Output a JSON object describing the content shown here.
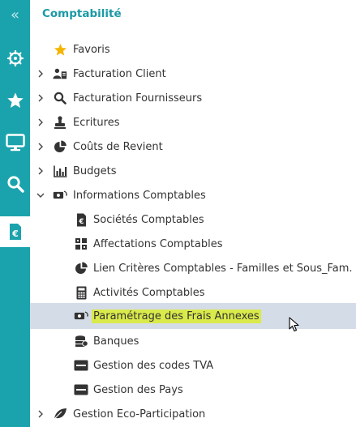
{
  "section_title": "Comptabilité",
  "rail": {
    "collapse_glyph": "«",
    "buttons": [
      {
        "icon": "settings-wheel-icon"
      },
      {
        "icon": "star-icon"
      },
      {
        "icon": "monitor-icon"
      },
      {
        "icon": "search-icon"
      },
      {
        "icon": "euro-document-icon",
        "active": true
      }
    ]
  },
  "menu": {
    "favoris": "Favoris",
    "facturation_client": "Facturation Client",
    "facturation_fournisseurs": "Facturation Fournisseurs",
    "ecritures": "Ecritures",
    "couts_de_revient": "Coûts de Revient",
    "budgets": "Budgets",
    "informations_comptables": {
      "label": "Informations Comptables",
      "expanded": true,
      "children": {
        "societes": "Sociétés Comptables",
        "affectations": "Affectations Comptables",
        "lien_criteres": "Lien Critères Comptables - Familles et Sous_Fam.",
        "activites": "Activités Comptables",
        "parametrage_frais": "Paramétrage des Frais Annexes",
        "banques": "Banques",
        "codes_tva": "Gestion des codes TVA",
        "pays": "Gestion des Pays"
      }
    },
    "eco_participation": "Gestion Eco-Participation"
  },
  "colors": {
    "rail": "#1aa3ad",
    "title": "#1a9aa5",
    "hover_row": "#d4dce7",
    "text_highlight": "#d9ea4a",
    "favoris_star": "#f5b400"
  }
}
